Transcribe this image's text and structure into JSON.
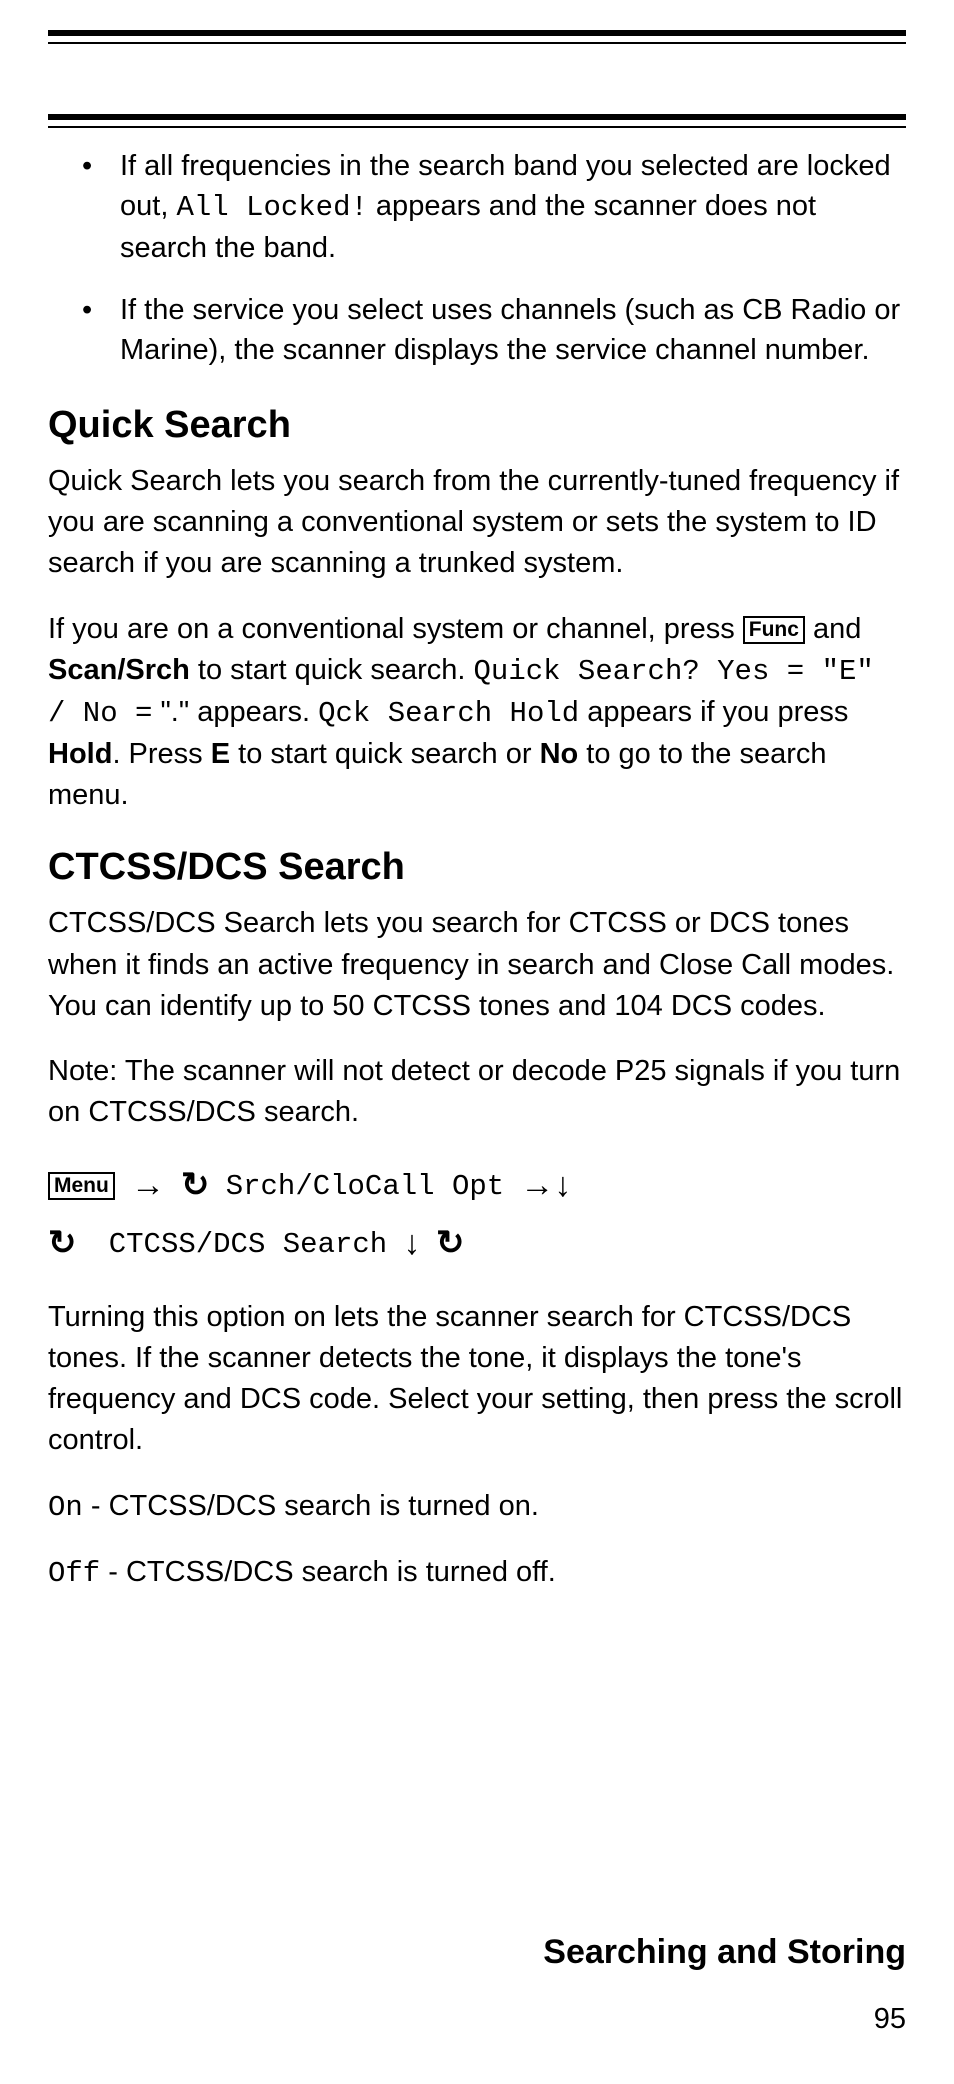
{
  "bullets": [
    {
      "pre": "If all frequencies in the search band you selected are locked out, ",
      "code": "All Locked!",
      "post": " appears and the scanner does not search the band."
    },
    {
      "text": "If the service you select uses channels (such as CB Radio or Marine), the scanner displays the service channel number."
    }
  ],
  "quick_search": {
    "heading": "Quick Search",
    "para1": "Quick Search lets you search from the currently-tuned frequency if you are scanning a conventional system or sets the system to ID search if you are scanning a trunked system.",
    "para2": {
      "pre": "If you are on a conventional system or channel, press ",
      "key": "Func",
      "mid1": " and ",
      "bold1": "Scan/Srch",
      "mid2": " to start quick search. ",
      "code1": "Quick Search? Yes = \"E\" / No =",
      "quote_dot": " \".\" ",
      "mid3": " appears. ",
      "code2": "Qck Search Hold",
      "mid4": " appears if you press ",
      "bold2": "Hold",
      "mid5": ". Press ",
      "bold3": "E",
      "mid6": " to start quick search or ",
      "bold4": "No",
      "mid7": " to go to the search menu."
    }
  },
  "ctcss": {
    "heading": "CTCSS/DCS Search",
    "para1": "CTCSS/DCS Search lets you search for CTCSS or DCS tones when it finds an active frequency in search and Close Call modes. You can identify up to 50 CTCSS tones and 104 DCS codes.",
    "note": "Note: The scanner will not detect or decode P25 signals if you turn on CTCSS/DCS search.",
    "nav": {
      "menu_key": "Menu",
      "item1": "Srch/CloCall Opt",
      "item2": "CTCSS/DCS Search"
    },
    "para2": "Turning this option on lets the scanner search for CTCSS/DCS tones. If the scanner detects the tone, it displays the tone's frequency and DCS code. Select your setting, then press the scroll control.",
    "on_code": "On",
    "on_text": " - CTCSS/DCS search is turned on.",
    "off_code": "Off",
    "off_text": " - CTCSS/DCS search is turned off."
  },
  "footer": {
    "title": "Searching and Storing",
    "page": "95"
  }
}
